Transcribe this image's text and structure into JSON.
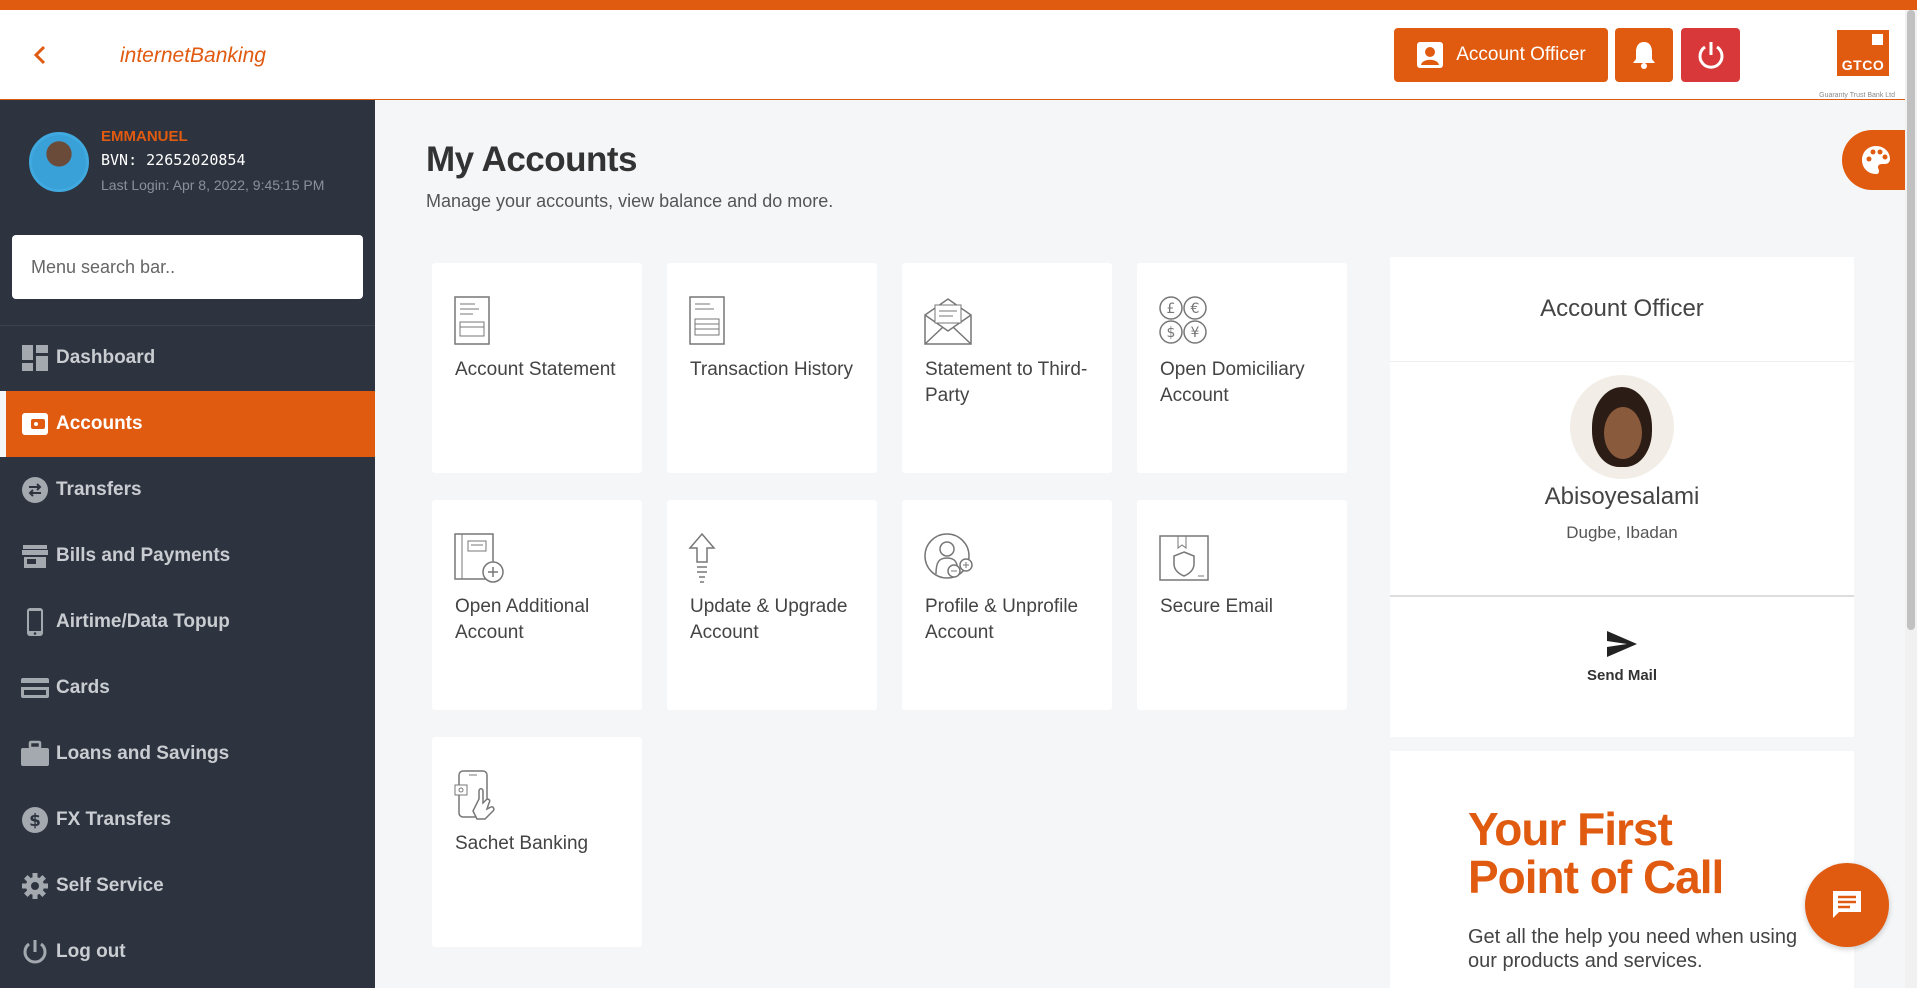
{
  "header": {
    "brand_part1": "internet",
    "brand_part2": "Banking",
    "account_officer_button": "Account Officer",
    "logo_text": "GTCO",
    "logo_subtext": "Guaranty Trust Bank Ltd"
  },
  "user": {
    "name": "EMMANUEL",
    "bvn": "BVN: 22652020854",
    "last_login": "Last Login: Apr 8, 2022, 9:45:15 PM"
  },
  "sidebar": {
    "search_placeholder": "Menu search bar..",
    "items": [
      {
        "label": "Dashboard",
        "icon": "dashboard-icon",
        "active": false
      },
      {
        "label": "Accounts",
        "icon": "wallet-icon",
        "active": true
      },
      {
        "label": "Transfers",
        "icon": "transfer-icon",
        "active": false
      },
      {
        "label": "Bills and Payments",
        "icon": "store-icon",
        "active": false
      },
      {
        "label": "Airtime/Data Topup",
        "icon": "phone-icon",
        "active": false
      },
      {
        "label": "Cards",
        "icon": "card-icon",
        "active": false
      },
      {
        "label": "Loans and Savings",
        "icon": "briefcase-icon",
        "active": false
      },
      {
        "label": "FX Transfers",
        "icon": "dollar-icon",
        "active": false
      },
      {
        "label": "Self Service",
        "icon": "gear-icon",
        "active": false
      },
      {
        "label": "Log out",
        "icon": "power-icon",
        "active": false
      }
    ]
  },
  "main": {
    "title": "My Accounts",
    "subtitle": "Manage your accounts, view balance and do more.",
    "cards": [
      {
        "label": "Account Statement",
        "icon": "statement-icon"
      },
      {
        "label": "Transaction History",
        "icon": "history-icon"
      },
      {
        "label": "Statement to Third-Party",
        "icon": "envelope-icon"
      },
      {
        "label": "Open Domiciliary Account",
        "icon": "currency-icon"
      },
      {
        "label": "Open Additional Account",
        "icon": "add-account-icon"
      },
      {
        "label": "Update & Upgrade Account",
        "icon": "upgrade-icon"
      },
      {
        "label": "Profile & Unprofile Account",
        "icon": "profile-icon"
      },
      {
        "label": "Secure Email",
        "icon": "secure-email-icon"
      },
      {
        "label": "Sachet Banking",
        "icon": "mobile-hand-icon"
      }
    ]
  },
  "officer": {
    "title": "Account Officer",
    "name": "Abisoyesalami",
    "location": "Dugbe, Ibadan",
    "send_mail": "Send Mail"
  },
  "promo": {
    "title": "Your First Point of Call",
    "text": "Get all the help you need when using our products and services."
  },
  "colors": {
    "brand": "#e05a10",
    "sidebar": "#2e343f",
    "danger": "#d9383a"
  }
}
